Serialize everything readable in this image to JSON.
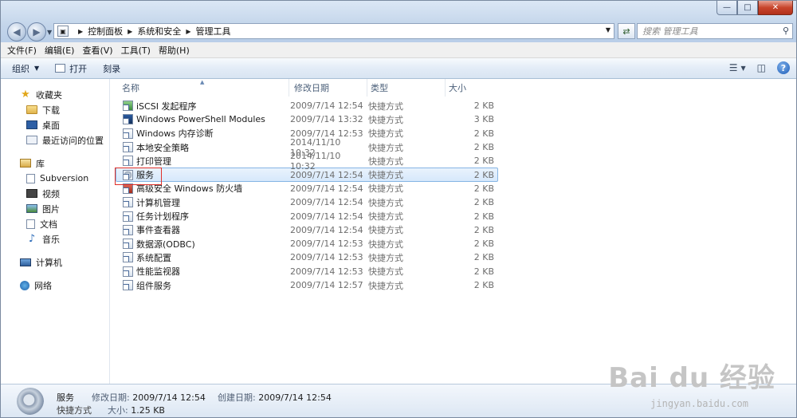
{
  "address": {
    "crumbs": [
      "控制面板",
      "系统和安全",
      "管理工具"
    ]
  },
  "search": {
    "placeholder": "搜索 管理工具"
  },
  "menubar": {
    "items": [
      "文件(F)",
      "编辑(E)",
      "查看(V)",
      "工具(T)",
      "帮助(H)"
    ]
  },
  "toolbar": {
    "organize": "组织",
    "open": "打开",
    "burn": "刻录"
  },
  "nav": {
    "favorites": "收藏夹",
    "downloads": "下载",
    "desktop": "桌面",
    "recent": "最近访问的位置",
    "libraries": "库",
    "subversion": "Subversion",
    "videos": "视频",
    "pictures": "图片",
    "documents": "文档",
    "music": "音乐",
    "computer": "计算机",
    "network": "网络"
  },
  "columns": {
    "name": "名称",
    "date": "修改日期",
    "type": "类型",
    "size": "大小"
  },
  "files": [
    {
      "name": "iSCSI 发起程序",
      "date": "2009/7/14 12:54",
      "type": "快捷方式",
      "size": "2 KB"
    },
    {
      "name": "Windows PowerShell Modules",
      "date": "2009/7/14 13:32",
      "type": "快捷方式",
      "size": "3 KB"
    },
    {
      "name": "Windows 内存诊断",
      "date": "2009/7/14 12:53",
      "type": "快捷方式",
      "size": "2 KB"
    },
    {
      "name": "本地安全策略",
      "date": "2014/11/10 10:32",
      "type": "快捷方式",
      "size": "2 KB"
    },
    {
      "name": "打印管理",
      "date": "2014/11/10 10:32",
      "type": "快捷方式",
      "size": "2 KB"
    },
    {
      "name": "服务",
      "date": "2009/7/14 12:54",
      "type": "快捷方式",
      "size": "2 KB"
    },
    {
      "name": "高级安全 Windows 防火墙",
      "date": "2009/7/14 12:54",
      "type": "快捷方式",
      "size": "2 KB"
    },
    {
      "name": "计算机管理",
      "date": "2009/7/14 12:54",
      "type": "快捷方式",
      "size": "2 KB"
    },
    {
      "name": "任务计划程序",
      "date": "2009/7/14 12:54",
      "type": "快捷方式",
      "size": "2 KB"
    },
    {
      "name": "事件查看器",
      "date": "2009/7/14 12:54",
      "type": "快捷方式",
      "size": "2 KB"
    },
    {
      "name": "数据源(ODBC)",
      "date": "2009/7/14 12:53",
      "type": "快捷方式",
      "size": "2 KB"
    },
    {
      "name": "系统配置",
      "date": "2009/7/14 12:53",
      "type": "快捷方式",
      "size": "2 KB"
    },
    {
      "name": "性能监视器",
      "date": "2009/7/14 12:53",
      "type": "快捷方式",
      "size": "2 KB"
    },
    {
      "name": "组件服务",
      "date": "2009/7/14 12:57",
      "type": "快捷方式",
      "size": "2 KB"
    }
  ],
  "details": {
    "name": "服务",
    "type": "快捷方式",
    "modified_label": "修改日期:",
    "modified": "2009/7/14 12:54",
    "created_label": "创建日期:",
    "created": "2009/7/14 12:54",
    "size_label": "大小:",
    "size": "1.25 KB"
  },
  "watermark": {
    "main": "Bai du 经验",
    "sub": "jingyan.baidu.com"
  }
}
